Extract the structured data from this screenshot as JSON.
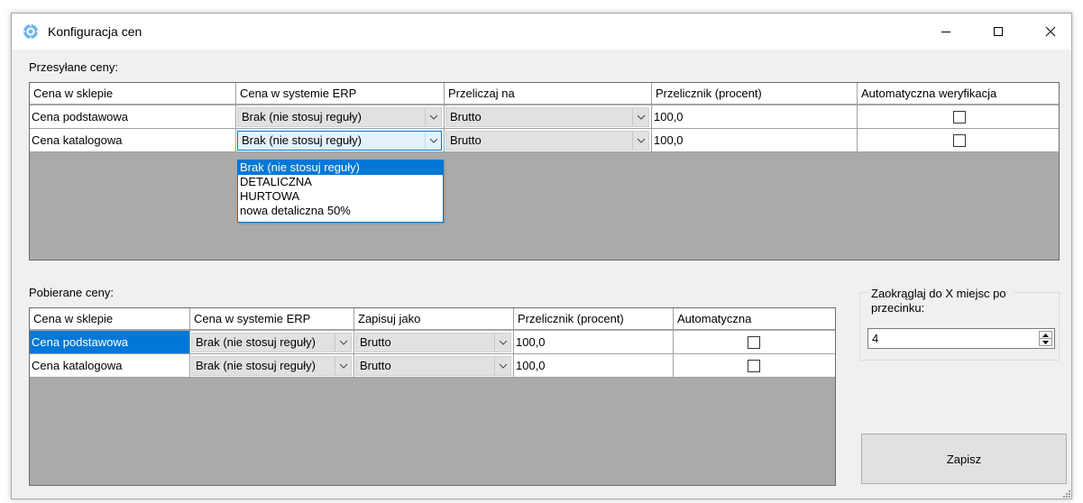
{
  "window": {
    "title": "Konfiguracja cen",
    "icon": "gear-app-icon"
  },
  "sent": {
    "label": "Przesyłane ceny:",
    "columns": [
      "Cena w sklepie",
      "Cena w systemie ERP",
      "Przeliczaj na",
      "Przelicznik (procent)",
      "Automatyczna weryfikacja"
    ],
    "rows": [
      {
        "shop": "Cena podstawowa",
        "erp": "Brak (nie stosuj reguły)",
        "convert": "Brutto",
        "factor": "100,0",
        "auto": false
      },
      {
        "shop": "Cena katalogowa",
        "erp": "Brak (nie stosuj reguły)",
        "convert": "Brutto",
        "factor": "100,0",
        "auto": false
      }
    ],
    "dropdown_options": [
      "Brak (nie stosuj reguły)",
      "DETALICZNA",
      "HURTOWA",
      "nowa detaliczna 50%"
    ]
  },
  "fetched": {
    "label": "Pobierane ceny:",
    "columns": [
      "Cena w sklepie",
      "Cena w systemie ERP",
      "Zapisuj jako",
      "Przelicznik (procent)",
      "Automatyczna"
    ],
    "rows": [
      {
        "shop": "Cena podstawowa",
        "erp": "Brak (nie stosuj reguły)",
        "save_as": "Brutto",
        "factor": "100,0",
        "auto": false
      },
      {
        "shop": "Cena katalogowa",
        "erp": "Brak (nie stosuj reguły)",
        "save_as": "Brutto",
        "factor": "100,0",
        "auto": false
      }
    ]
  },
  "rounding": {
    "label": "Zaokrąglaj do X miejsc po przecinku:",
    "value": "4"
  },
  "save_button": "Zapisz",
  "colors": {
    "selection": "#0078d7",
    "grid_background": "#aaaaaa",
    "window_background": "#f0f0f0"
  }
}
